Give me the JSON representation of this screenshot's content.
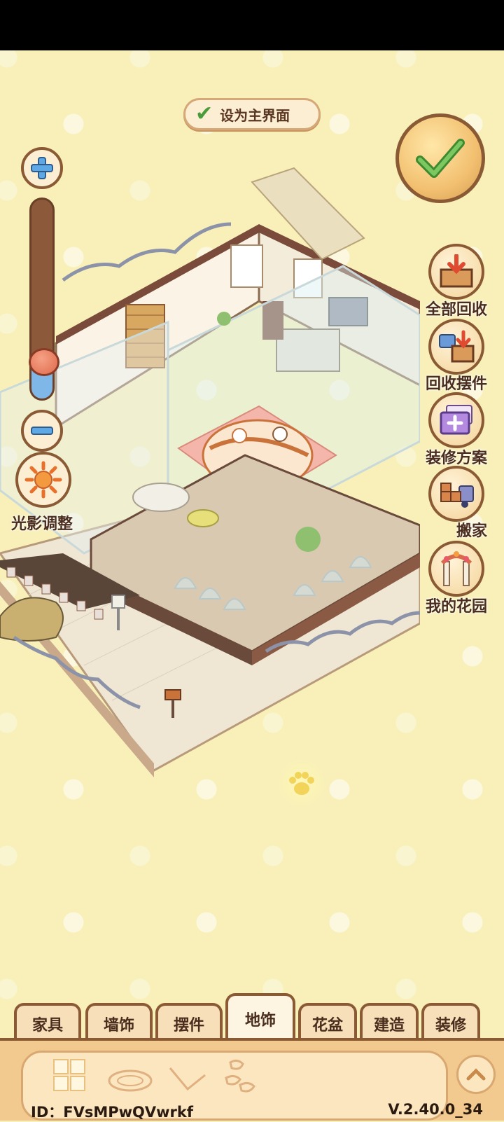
{
  "top": {
    "set_home_label": "设为主界面"
  },
  "left_controls": {
    "light_label": "光影调整"
  },
  "side_menu": [
    {
      "label": "全部回收",
      "icon": "recycle-box-icon"
    },
    {
      "label": "回收摆件",
      "icon": "recycle-ornament-icon"
    },
    {
      "label": "装修方案",
      "icon": "decoration-plan-icon"
    },
    {
      "label": "搬家",
      "icon": "moving-truck-icon"
    },
    {
      "label": "我的花园",
      "icon": "garden-arch-icon"
    }
  ],
  "tabs": [
    {
      "label": "家具"
    },
    {
      "label": "墙饰"
    },
    {
      "label": "摆件"
    },
    {
      "label": "地饰",
      "active": true
    },
    {
      "label": "花盆"
    },
    {
      "label": "建造"
    },
    {
      "label": "装修"
    }
  ],
  "footer": {
    "id_text": "ID：FVsMPwQVwrkf",
    "version": "V.2.40.0_34"
  },
  "colors": {
    "accent": "#8a5a35",
    "panel": "#f2c98e",
    "background": "#f8f0b8",
    "check_green": "#4a9b3a"
  }
}
